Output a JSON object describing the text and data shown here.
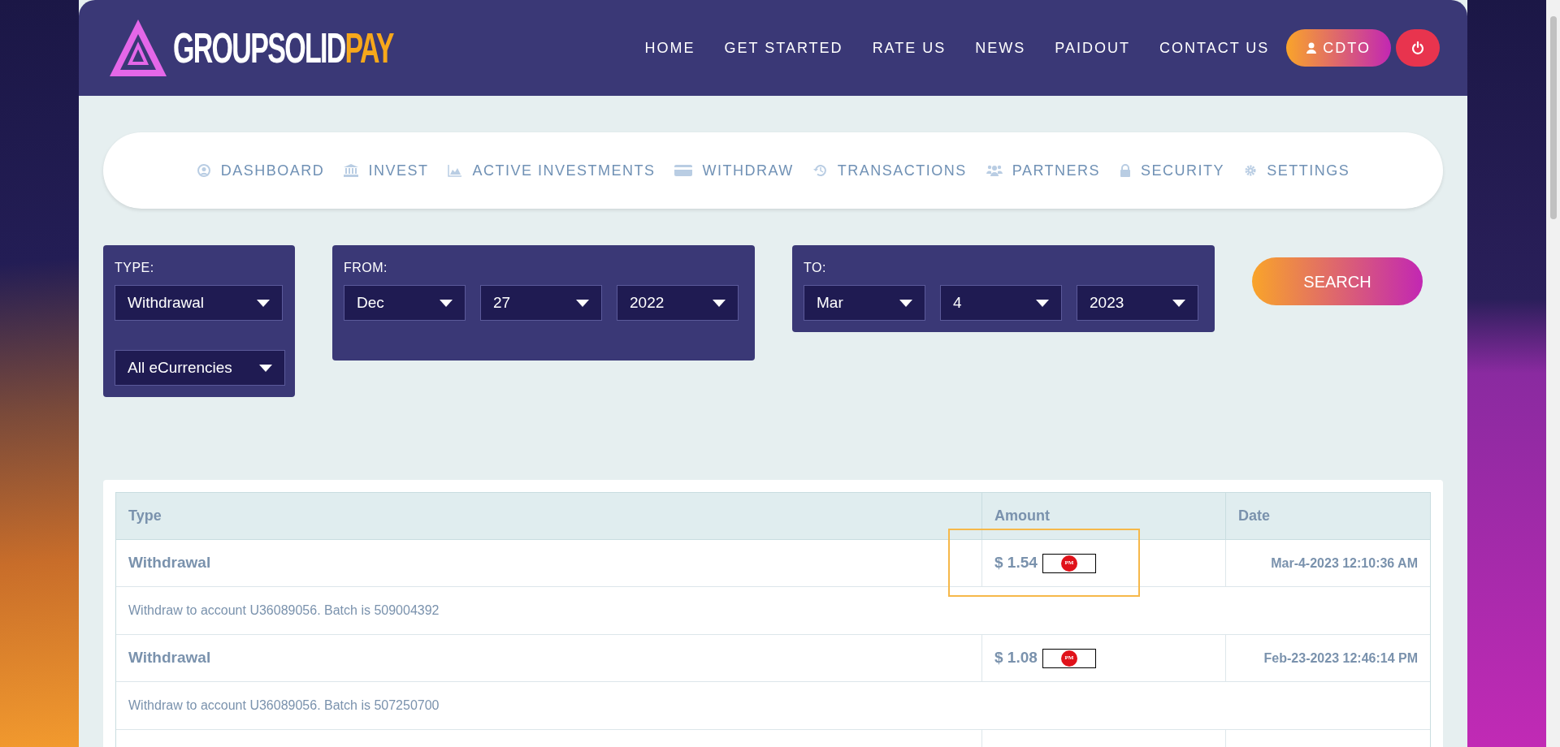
{
  "header": {
    "logo": {
      "main": "GROUPSOLID",
      "accent": "PAY"
    },
    "menu": [
      {
        "label": "HOME"
      },
      {
        "label": "GET STARTED"
      },
      {
        "label": "RATE US"
      },
      {
        "label": "NEWS"
      },
      {
        "label": "PAIDOUT"
      },
      {
        "label": "CONTACT US"
      }
    ],
    "user_button": "CDTO"
  },
  "account_nav": [
    {
      "kind": "user",
      "label": "DASHBOARD"
    },
    {
      "kind": "bank",
      "label": "INVEST"
    },
    {
      "kind": "chart",
      "label": "ACTIVE INVESTMENTS"
    },
    {
      "kind": "card",
      "label": "WITHDRAW"
    },
    {
      "kind": "history",
      "label": "TRANSACTIONS"
    },
    {
      "kind": "users",
      "label": "PARTNERS"
    },
    {
      "kind": "lock",
      "label": "SECURITY"
    },
    {
      "kind": "gear",
      "label": "SETTINGS"
    }
  ],
  "filters": {
    "type": {
      "label": "TYPE:",
      "selects": [
        "Withdrawal",
        "All eCurrencies"
      ]
    },
    "from": {
      "label": "FROM:",
      "selects": [
        "Dec",
        "27",
        "2022"
      ]
    },
    "to": {
      "label": "TO:",
      "selects": [
        "Mar",
        "4",
        "2023"
      ]
    },
    "search_button": "SEARCH"
  },
  "table": {
    "columns": [
      "Type",
      "Amount",
      "Date"
    ],
    "rows": [
      {
        "type": "Withdrawal",
        "amount": "$ 1.54",
        "currency": "PM",
        "date": "Mar-4-2023 12:10:36 AM",
        "description": "Withdraw to account U36089056. Batch is 509004392",
        "highlighted": true
      },
      {
        "type": "Withdrawal",
        "amount": "$ 1.08",
        "currency": "PM",
        "date": "Feb-23-2023 12:46:14 PM",
        "description": "Withdraw to account U36089056. Batch is 507250700",
        "highlighted": false
      }
    ]
  }
}
